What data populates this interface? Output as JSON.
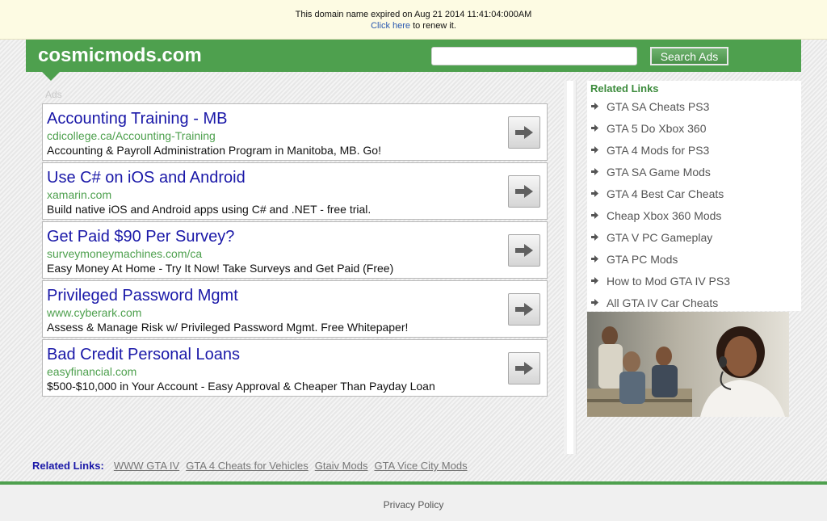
{
  "notice": {
    "expired_text": "This domain name expired on Aug 21 2014 11:41:04:000AM",
    "renew_link": "Click here",
    "renew_suffix": " to renew it."
  },
  "header": {
    "site_name": "cosmicmods.com",
    "search_placeholder": "",
    "search_button": "Search Ads",
    "accent_color": "#4ea04e"
  },
  "ads_label": "Ads",
  "ads": [
    {
      "title": "Accounting Training - MB",
      "url": "cdicollege.ca/Accounting-Training",
      "desc": "Accounting & Payroll Administration Program in Manitoba, MB. Go!"
    },
    {
      "title": "Use C# on iOS and Android",
      "url": "xamarin.com",
      "desc": "Build native iOS and Android apps using C# and .NET - free trial."
    },
    {
      "title": "Get Paid $90 Per Survey?",
      "url": "surveymoneymachines.com/ca",
      "desc": "Easy Money At Home - Try It Now! Take Surveys and Get Paid (Free)"
    },
    {
      "title": "Privileged Password Mgmt",
      "url": "www.cyberark.com",
      "desc": "Assess & Manage Risk w/ Privileged Password Mgmt. Free Whitepaper!"
    },
    {
      "title": "Bad Credit Personal Loans",
      "url": "easyfinancial.com",
      "desc": "$500-$10,000 in Your Account - Easy Approval & Cheaper Than Payday Loan"
    }
  ],
  "related": {
    "title": "Related Links",
    "items": [
      "GTA SA Cheats PS3",
      "GTA 5 Do Xbox 360",
      "GTA 4 Mods for PS3",
      "GTA SA Game Mods",
      "GTA 4 Best Car Cheats",
      "Cheap Xbox 360 Mods",
      "GTA V PC Gameplay",
      "GTA PC Mods",
      "How to Mod GTA IV PS3",
      "All GTA IV Car Cheats"
    ]
  },
  "bottom": {
    "label": "Related Links:",
    "links": [
      "WWW GTA IV",
      "GTA 4 Cheats for Vehicles",
      "Gtaiv Mods",
      "GTA Vice City Mods"
    ]
  },
  "footer": {
    "privacy": "Privacy Policy"
  }
}
